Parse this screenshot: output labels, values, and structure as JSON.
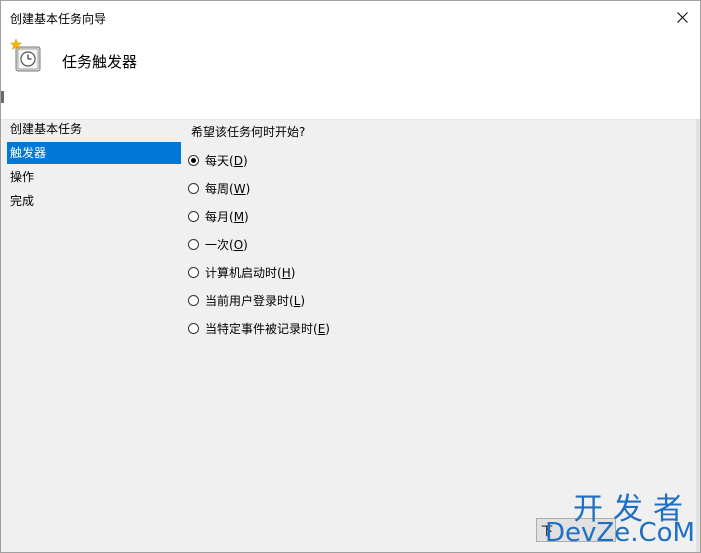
{
  "window": {
    "title": "创建基本任务向导",
    "close_icon": "close-icon"
  },
  "header": {
    "icon": "task-scheduler-clock-icon",
    "title": "任务触发器"
  },
  "sidebar": {
    "items": [
      {
        "label": "创建基本任务",
        "selected": false
      },
      {
        "label": "触发器",
        "selected": true
      },
      {
        "label": "操作",
        "selected": false
      },
      {
        "label": "完成",
        "selected": false
      }
    ]
  },
  "main": {
    "question": "希望该任务何时开始?",
    "options": [
      {
        "text": "每天(",
        "key": "D",
        "close": ")",
        "checked": true
      },
      {
        "text": "每周(",
        "key": "W",
        "close": ")",
        "checked": false
      },
      {
        "text": "每月(",
        "key": "M",
        "close": ")",
        "checked": false
      },
      {
        "text": "一次(",
        "key": "O",
        "close": ")",
        "checked": false
      },
      {
        "text": "计算机启动时(",
        "key": "H",
        "close": ")",
        "checked": false
      },
      {
        "text": "当前用户登录时(",
        "key": "L",
        "close": ")",
        "checked": false
      },
      {
        "text": "当特定事件被记录时(",
        "key": "E",
        "close": ")",
        "checked": false
      }
    ]
  },
  "footer": {
    "next_label": "下"
  },
  "watermark": {
    "top": "开发者",
    "bottom": "DevZe.CoM"
  },
  "colors": {
    "selection": "#0078d7",
    "window_bg": "#f0f0f0",
    "header_bg": "#ffffff",
    "watermark": "#1f6fc4"
  }
}
